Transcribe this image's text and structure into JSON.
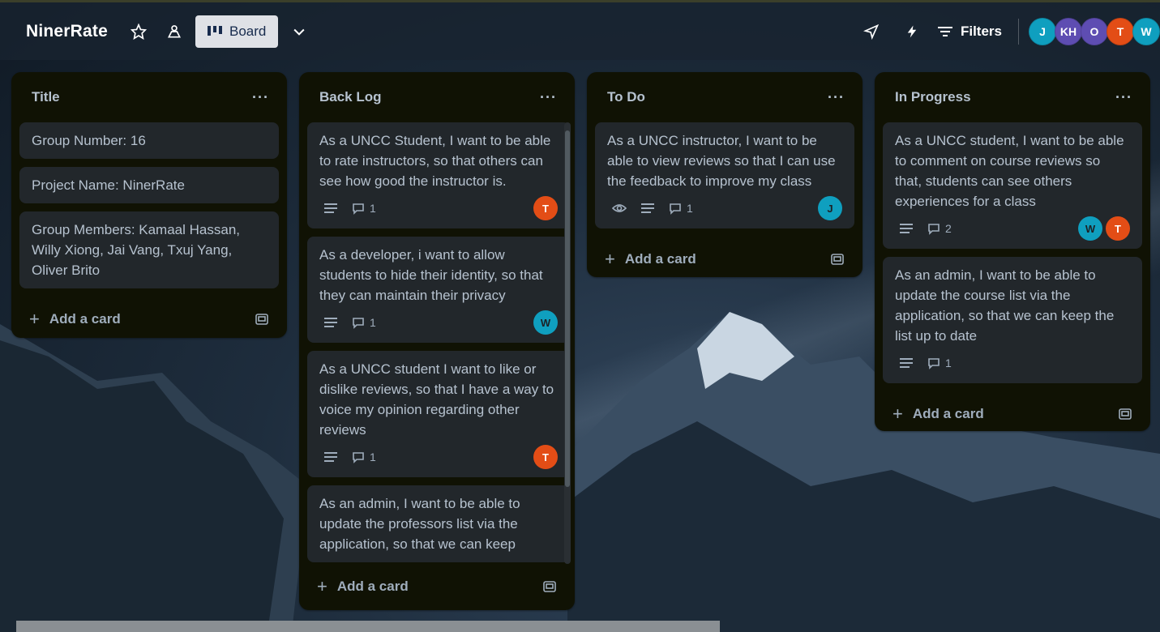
{
  "header": {
    "board_name": "NinerRate",
    "view_label": "Board",
    "filters_label": "Filters",
    "avatars": [
      {
        "initials": "J",
        "color": "#0f9fbf"
      },
      {
        "initials": "KH",
        "color": "#5e4db2"
      },
      {
        "initials": "O",
        "color": "#5e4db2"
      },
      {
        "initials": "T",
        "color": "#e34d16"
      },
      {
        "initials": "W",
        "color": "#0f9fbf"
      }
    ]
  },
  "lists": [
    {
      "title": "Title",
      "add_label": "Add a card",
      "cards": [
        {
          "text": "Group Number: 16"
        },
        {
          "text": "Project Name: NinerRate"
        },
        {
          "text": "Group Members: Kamaal Hassan, Willy Xiong, Jai Vang, Txuj Yang, Oliver Brito"
        }
      ]
    },
    {
      "title": "Back Log",
      "add_label": "Add a card",
      "cards": [
        {
          "text": "As a UNCC Student, I want to be able to rate instructors, so that others can see how good the instructor is.",
          "comments": "1",
          "members": [
            "T"
          ]
        },
        {
          "text": "As a developer, i want to allow students to hide their identity, so that they can maintain their privacy",
          "comments": "1",
          "members": [
            "W"
          ]
        },
        {
          "text": "As a UNCC student I want to like or dislike reviews, so that I have a way to voice my opinion regarding other reviews",
          "comments": "1",
          "members": [
            "T"
          ]
        },
        {
          "text": "As an admin, I want to be able to update the professors list via the application, so that we can keep"
        }
      ]
    },
    {
      "title": "To Do",
      "add_label": "Add a card",
      "cards": [
        {
          "text": "As a UNCC instructor, I want to be able to view reviews so that I can use the feedback to improve my class",
          "comments": "1",
          "members": [
            "J"
          ]
        }
      ]
    },
    {
      "title": "In Progress",
      "add_label": "Add a card",
      "cards": [
        {
          "text": "As a UNCC student, I want to be able to comment on course reviews so that, students can see others experiences for a class",
          "comments": "2",
          "members": [
            "W",
            "T"
          ]
        },
        {
          "text": "As an admin, I want to be able to update the course list via the application, so that we can keep the list up to date",
          "comments": "1"
        }
      ]
    }
  ]
}
